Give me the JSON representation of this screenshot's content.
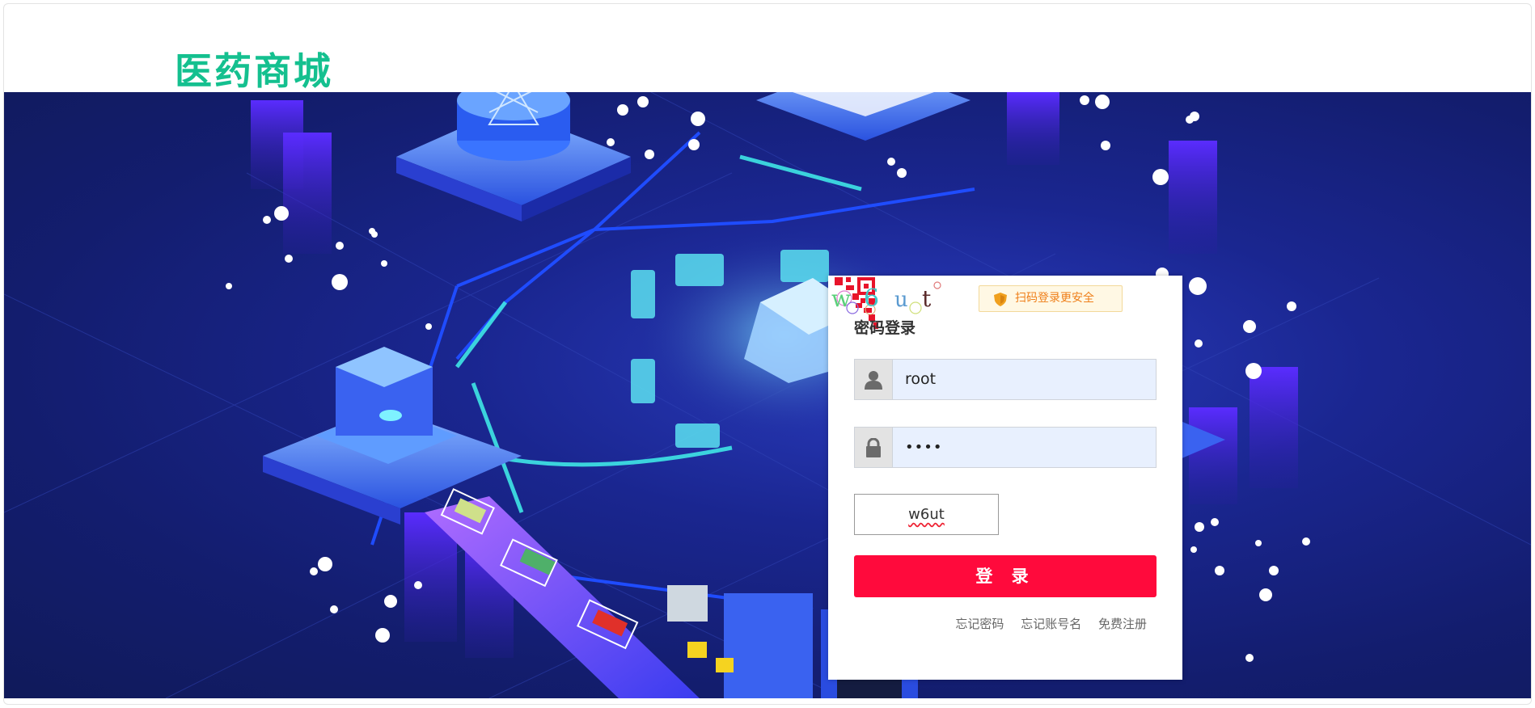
{
  "header": {
    "brand": "医药商城",
    "brand_color": "#14c08f"
  },
  "login": {
    "qr_tip": "扫码登录更安全",
    "title": "密码登录",
    "username_value": "root",
    "password_value": "••••",
    "captcha_input_value": "w6ut",
    "captcha_image_text": "w6 ut",
    "submit_label": "登 录",
    "links": {
      "forgot_password": "忘记密码",
      "forgot_account": "忘记账号名",
      "register": "免费注册"
    }
  },
  "colors": {
    "accent_red": "#ff0a3c",
    "hero_blue": "#1a2690",
    "tip_orange": "#ef7f1a"
  }
}
